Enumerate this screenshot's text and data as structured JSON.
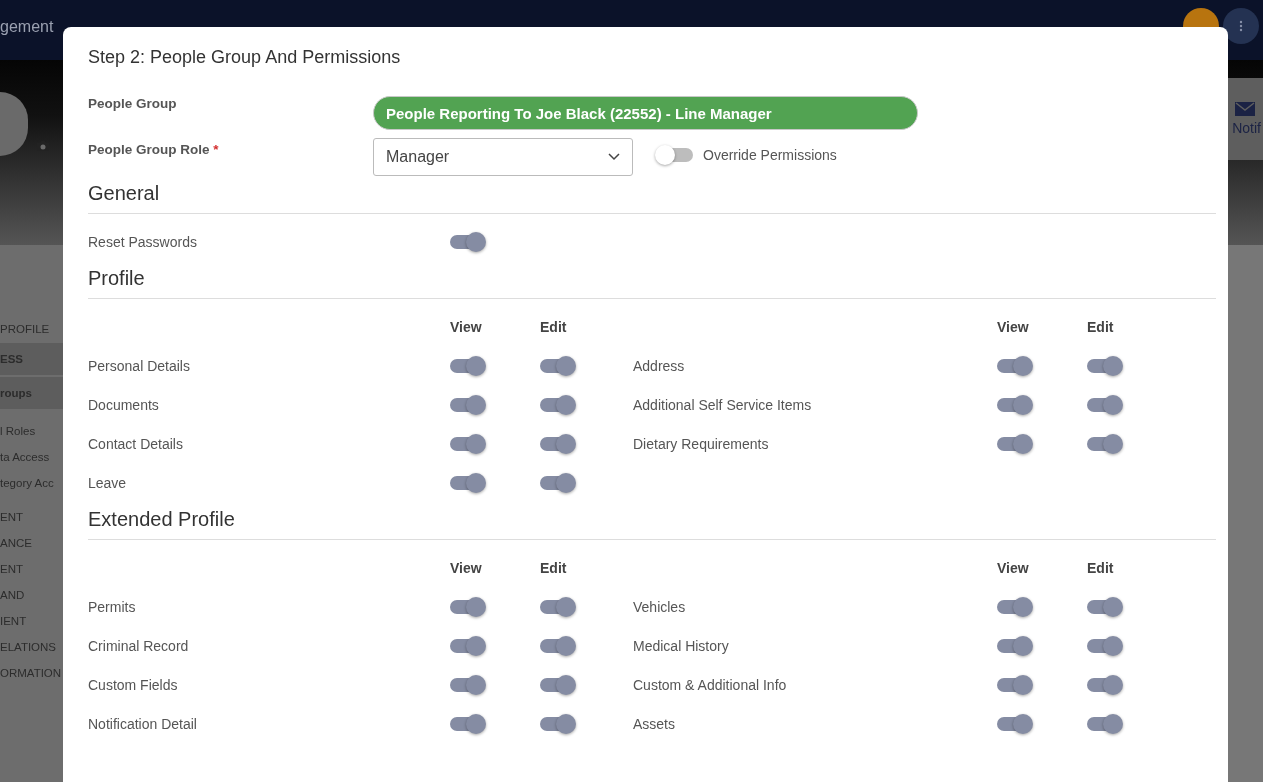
{
  "navbar": {
    "title_fragment": "gement"
  },
  "sidebar": {
    "items": [
      {
        "label": "PROFILE",
        "selected": false
      },
      {
        "label": "ESS",
        "selected": true
      },
      {
        "label": "roups",
        "selected": true
      },
      {
        "label": "l Roles",
        "selected": false
      },
      {
        "label": "ta Access",
        "selected": false
      },
      {
        "label": "tegory Acc",
        "selected": false
      },
      {
        "label": "ENT",
        "selected": false
      },
      {
        "label": "ANCE",
        "selected": false
      },
      {
        "label": "ENT",
        "selected": false
      },
      {
        "label": "AND",
        "selected": false
      },
      {
        "label": "IENT",
        "selected": false
      },
      {
        "label": "ELATIONS",
        "selected": false
      },
      {
        "label": "ORMATION",
        "selected": false
      }
    ]
  },
  "right_panel": {
    "label": "Notif"
  },
  "dialog": {
    "title": "Step 2: People Group And Permissions",
    "people_group": {
      "label": "People Group",
      "value": "People Reporting To Joe Black (22552) - Line Manager"
    },
    "role": {
      "label": "People Group Role",
      "required": true,
      "required_mark": "*",
      "value": "Manager"
    },
    "override": {
      "label": "Override Permissions",
      "on": false
    },
    "sections": [
      {
        "title": "General",
        "kind": "single",
        "rows": [
          {
            "label": "Reset Passwords",
            "on": true
          }
        ]
      },
      {
        "title": "Profile",
        "kind": "matrix",
        "columns": [
          "View",
          "Edit",
          "View",
          "Edit"
        ],
        "rows": [
          {
            "left": {
              "label": "Personal Details",
              "view": true,
              "edit": true
            },
            "right": {
              "label": "Address",
              "view": true,
              "edit": true
            }
          },
          {
            "left": {
              "label": "Documents",
              "view": true,
              "edit": true
            },
            "right": {
              "label": "Additional Self Service Items",
              "view": true,
              "edit": true
            }
          },
          {
            "left": {
              "label": "Contact Details",
              "view": true,
              "edit": true
            },
            "right": {
              "label": "Dietary Requirements",
              "view": true,
              "edit": true
            }
          },
          {
            "left": {
              "label": "Leave",
              "view": true,
              "edit": true
            }
          }
        ]
      },
      {
        "title": "Extended Profile",
        "kind": "matrix",
        "columns": [
          "View",
          "Edit",
          "View",
          "Edit"
        ],
        "rows": [
          {
            "left": {
              "label": "Permits",
              "view": true,
              "edit": true
            },
            "right": {
              "label": "Vehicles",
              "view": true,
              "edit": true
            }
          },
          {
            "left": {
              "label": "Criminal Record",
              "view": true,
              "edit": true
            },
            "right": {
              "label": "Medical History",
              "view": true,
              "edit": true
            }
          },
          {
            "left": {
              "label": "Custom Fields",
              "view": true,
              "edit": true
            },
            "right": {
              "label": "Custom & Additional Info",
              "view": true,
              "edit": true
            }
          },
          {
            "left": {
              "label": "Notification Detail",
              "view": true,
              "edit": true
            },
            "right": {
              "label": "Assets",
              "view": true,
              "edit": true
            }
          }
        ]
      }
    ]
  }
}
